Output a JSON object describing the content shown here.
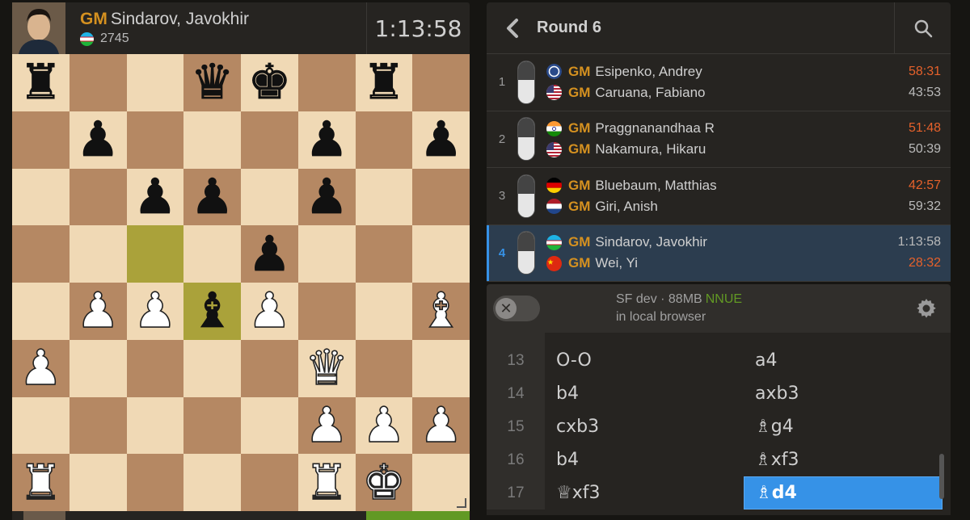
{
  "top_player": {
    "title": "GM",
    "name": "Sindarov, Javokhir",
    "rating": "2745",
    "clock": "1:13:58"
  },
  "board": {
    "highlight": [
      "c5",
      "d4"
    ],
    "ranks": [
      [
        "bR",
        "",
        "",
        "bQ",
        "bK",
        "",
        "bR",
        ""
      ],
      [
        "",
        "bP",
        "",
        "",
        "",
        "bP",
        "",
        "bP"
      ],
      [
        "",
        "",
        "bP",
        "bP",
        "",
        "bP",
        "",
        ""
      ],
      [
        "",
        "",
        "",
        "",
        "bP",
        "",
        "",
        ""
      ],
      [
        "",
        "wP",
        "wP",
        "bB",
        "wP",
        "",
        "",
        "wB"
      ],
      [
        "wP",
        "",
        "",
        "",
        "",
        "wQ",
        "",
        ""
      ],
      [
        "",
        "",
        "",
        "",
        "",
        "wP",
        "wP",
        "wP"
      ],
      [
        "wR",
        "",
        "",
        "",
        "",
        "wR",
        "wK",
        ""
      ]
    ]
  },
  "round": {
    "back_icon": "chevron-left-icon",
    "title": "Round 6",
    "search_icon": "search-icon",
    "games": [
      {
        "num": "1",
        "p1": {
          "title": "GM",
          "name": "Esipenko, Andrey",
          "clock": "58:31",
          "running": true
        },
        "p2": {
          "title": "GM",
          "name": "Caruana, Fabiano",
          "clock": "43:53",
          "running": false
        },
        "eval_black": 0.45
      },
      {
        "num": "2",
        "p1": {
          "title": "GM",
          "name": "Praggnanandhaa R",
          "clock": "51:48",
          "running": true
        },
        "p2": {
          "title": "GM",
          "name": "Nakamura, Hikaru",
          "clock": "50:39",
          "running": false
        },
        "eval_black": 0.45
      },
      {
        "num": "3",
        "p1": {
          "title": "GM",
          "name": "Bluebaum, Matthias",
          "clock": "42:57",
          "running": true
        },
        "p2": {
          "title": "GM",
          "name": "Giri, Anish",
          "clock": "59:32",
          "running": false
        },
        "eval_black": 0.45
      },
      {
        "num": "4",
        "p1": {
          "title": "GM",
          "name": "Sindarov, Javokhir",
          "clock": "1:13:58",
          "running": false
        },
        "p2": {
          "title": "GM",
          "name": "Wei, Yi",
          "clock": "28:32",
          "running": true
        },
        "eval_black": 0.45,
        "active": true
      }
    ]
  },
  "engine": {
    "name": "SF dev · 88MB",
    "badge": "NNUE",
    "location": "in local browser",
    "gear_icon": "gear-icon"
  },
  "moves": [
    {
      "num": "13",
      "white": "O-O",
      "black": "a4"
    },
    {
      "num": "14",
      "white": "b4",
      "black": "axb3"
    },
    {
      "num": "15",
      "white": "cxb3",
      "black": "♗g4"
    },
    {
      "num": "16",
      "white": "b4",
      "black": "♗xf3"
    },
    {
      "num": "17",
      "white": "♕xf3",
      "black": "♗d4",
      "current": "black"
    }
  ],
  "colors": {
    "accent": "#3692e7",
    "title_gold": "#d59120",
    "running_clock": "#e5612b",
    "nnue_green": "#629924"
  }
}
